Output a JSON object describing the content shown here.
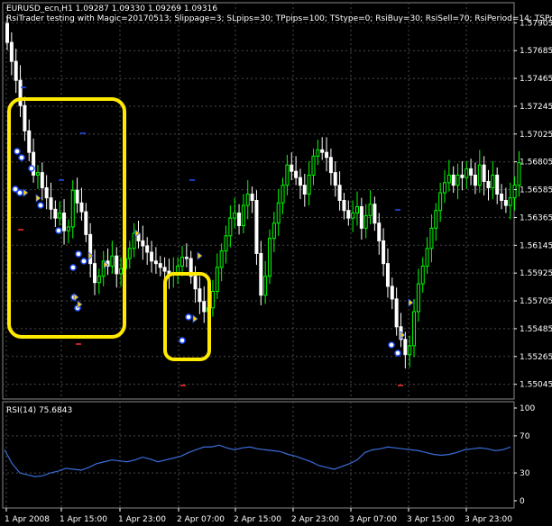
{
  "chart_header": {
    "symbol_line": "EURUSD_ecn,H1 1.09287 1.09330 1.09269 1.09316",
    "ea_line": "RsiTrader testing with Magic=20170513; Slippage=3; SLpips=30; TPpips=100; TStype=0; RsiBuy=30; RsiSell=70; RsiPeriod=14; TSPo"
  },
  "price_axis": {
    "labels": [
      "1.57905",
      "1.57685",
      "1.57465",
      "1.57245",
      "1.57025",
      "1.56805",
      "1.56585",
      "1.56365",
      "1.56145",
      "1.55925",
      "1.55705",
      "1.55485",
      "1.55265",
      "1.55045"
    ],
    "range": [
      1.5495,
      1.58
    ]
  },
  "rsi_panel": {
    "label": "RSI(14) 75.6843",
    "levels": [
      "100",
      "70",
      "30",
      "0"
    ],
    "range": [
      0,
      100
    ]
  },
  "time_axis": {
    "labels": [
      "1 Apr 2008",
      "1 Apr 15:00",
      "1 Apr 23:00",
      "2 Apr 07:00",
      "2 Apr 15:00",
      "2 Apr 23:00",
      "3 Apr 07:00",
      "3 Apr 15:00",
      "3 Apr 23:00"
    ]
  },
  "highlights": {
    "color": "#ffea00",
    "count": 2
  },
  "colors": {
    "background": "#000000",
    "grid": "#4a4a4a",
    "bull_candle": "#00ff00",
    "bear_candle": "#ffffff",
    "rsi_line": "#3b6cd8",
    "axis_text": "#ffffff"
  },
  "icons": {
    "buy_arrow": "blue-white-arrow-icon",
    "sell_arrow": "yellow-arrow-icon"
  }
}
